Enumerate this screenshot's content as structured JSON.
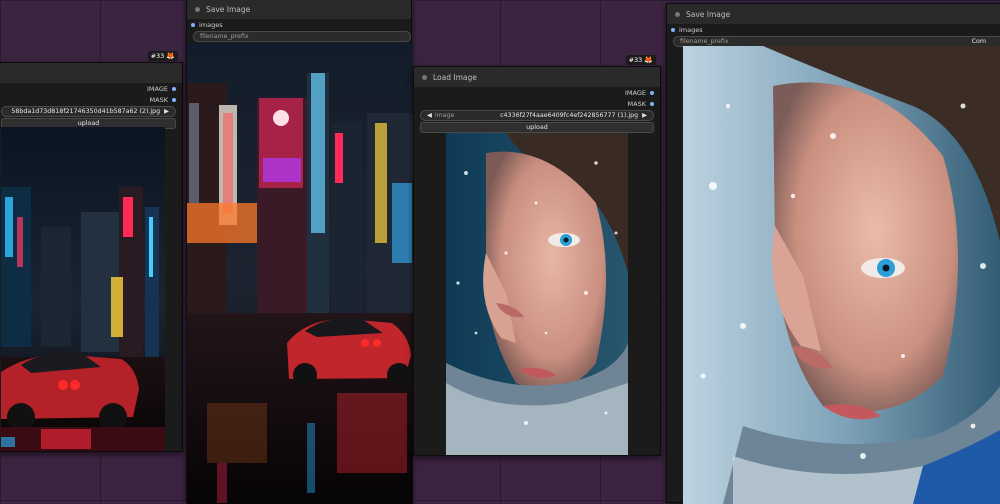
{
  "nodes": {
    "load1": {
      "badge": "#33",
      "out_image": "IMAGE",
      "out_mask": "MASK",
      "filename": "58bda1d73d818f21746350d41b587a62 (2).jpg",
      "upload": "upload"
    },
    "save1": {
      "title": "Save Image",
      "input": "images",
      "filename_prefix_label": "filename_prefix"
    },
    "load2": {
      "title": "Load Image",
      "badge": "#33",
      "out_image": "IMAGE",
      "out_mask": "MASK",
      "image_label": "image",
      "filename": "c4336f27f4aae6409fc4ef242856777 (1).jpg",
      "upload": "upload"
    },
    "save2": {
      "title": "Save Image",
      "input": "images",
      "filename_prefix_label": "filename_prefix",
      "filename_prefix_value": "Com"
    }
  },
  "colors": {
    "canvas": "#3b2440",
    "node": "#1b1b1b",
    "title": "#2a2a2a",
    "slot": "#7fb3ff"
  }
}
